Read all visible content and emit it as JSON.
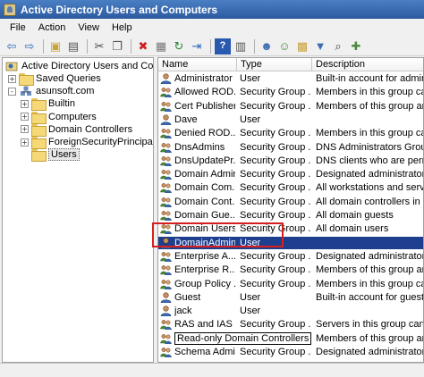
{
  "window": {
    "title": "Active Directory Users and Computers"
  },
  "menu": [
    "File",
    "Action",
    "View",
    "Help"
  ],
  "toolbar": [
    "back-arrow-icon",
    "forward-arrow-icon",
    "up-folder-icon",
    "tree-toggle-icon",
    "cut-icon",
    "copy-icon",
    "delete-icon",
    "properties-icon",
    "refresh-icon",
    "export-icon",
    "help-icon",
    "console-icon",
    "new-user-icon",
    "new-group-icon",
    "new-ou-icon",
    "filter-icon",
    "find-icon",
    "add-to-group-icon"
  ],
  "tree": {
    "root": "Active Directory Users and Comput",
    "items": [
      {
        "label": "Saved Queries",
        "level": 1,
        "expander": "+"
      },
      {
        "label": "asunsoft.com",
        "level": 1,
        "expander": "-"
      },
      {
        "label": "Builtin",
        "level": 2,
        "expander": "+"
      },
      {
        "label": "Computers",
        "level": 2,
        "expander": "+"
      },
      {
        "label": "Domain Controllers",
        "level": 2,
        "expander": "+"
      },
      {
        "label": "ForeignSecurityPrincipals",
        "level": 2,
        "expander": "+"
      },
      {
        "label": "Users",
        "level": 2,
        "expander": ""
      }
    ]
  },
  "columns": [
    "Name",
    "Type",
    "Description"
  ],
  "rows": [
    {
      "name": "Administrator",
      "type": "User",
      "description": "Built-in account for admini...",
      "icon": "user-icon"
    },
    {
      "name": "Allowed ROD...",
      "type": "Security Group ...",
      "description": "Members in this group can ...",
      "icon": "group-icon"
    },
    {
      "name": "Cert Publishers",
      "type": "Security Group ...",
      "description": "Members of this group are ...",
      "icon": "group-icon"
    },
    {
      "name": "Dave",
      "type": "User",
      "description": "",
      "icon": "user-icon"
    },
    {
      "name": "Denied ROD...",
      "type": "Security Group ...",
      "description": "Members in this group can ...",
      "icon": "group-icon"
    },
    {
      "name": "DnsAdmins",
      "type": "Security Group ...",
      "description": "DNS Administrators Group",
      "icon": "group-icon"
    },
    {
      "name": "DnsUpdatePr...",
      "type": "Security Group ...",
      "description": "DNS clients who are permi...",
      "icon": "group-icon"
    },
    {
      "name": "Domain Admins",
      "type": "Security Group ...",
      "description": "Designated administrators ...",
      "icon": "group-icon"
    },
    {
      "name": "Domain Com...",
      "type": "Security Group ...",
      "description": "All workstations and serve...",
      "icon": "group-icon"
    },
    {
      "name": "Domain Cont...",
      "type": "Security Group ...",
      "description": "All domain controllers in th...",
      "icon": "group-icon"
    },
    {
      "name": "Domain Gue...",
      "type": "Security Group ...",
      "description": "All domain guests",
      "icon": "group-icon"
    },
    {
      "name": "Domain Users",
      "type": "Security Group ...",
      "description": "All domain users",
      "icon": "group-icon"
    },
    {
      "name": "DomainAdmin",
      "type": "User",
      "description": "",
      "icon": "user-icon",
      "selected": true
    },
    {
      "name": "Enterprise A...",
      "type": "Security Group ...",
      "description": "Designated administrators ...",
      "icon": "group-icon"
    },
    {
      "name": "Enterprise R...",
      "type": "Security Group ...",
      "description": "Members of this group are ...",
      "icon": "group-icon"
    },
    {
      "name": "Group Policy ...",
      "type": "Security Group ...",
      "description": "Members in this group can ...",
      "icon": "group-icon"
    },
    {
      "name": "Guest",
      "type": "User",
      "description": "Built-in account for guest ...",
      "icon": "user-icon"
    },
    {
      "name": "jack",
      "type": "User",
      "description": "",
      "icon": "user-icon"
    },
    {
      "name": "RAS and IAS ...",
      "type": "Security Group ...",
      "description": "Servers in this group can ...",
      "icon": "group-icon"
    },
    {
      "name": "Read-only Domain Controllers",
      "type": "Security Group ...",
      "description": "Members of this group are ...",
      "icon": "group-icon",
      "editing": true
    },
    {
      "name": "Schema Admins",
      "type": "Security Group ...",
      "description": "Designated administrators ...",
      "icon": "group-icon"
    }
  ]
}
